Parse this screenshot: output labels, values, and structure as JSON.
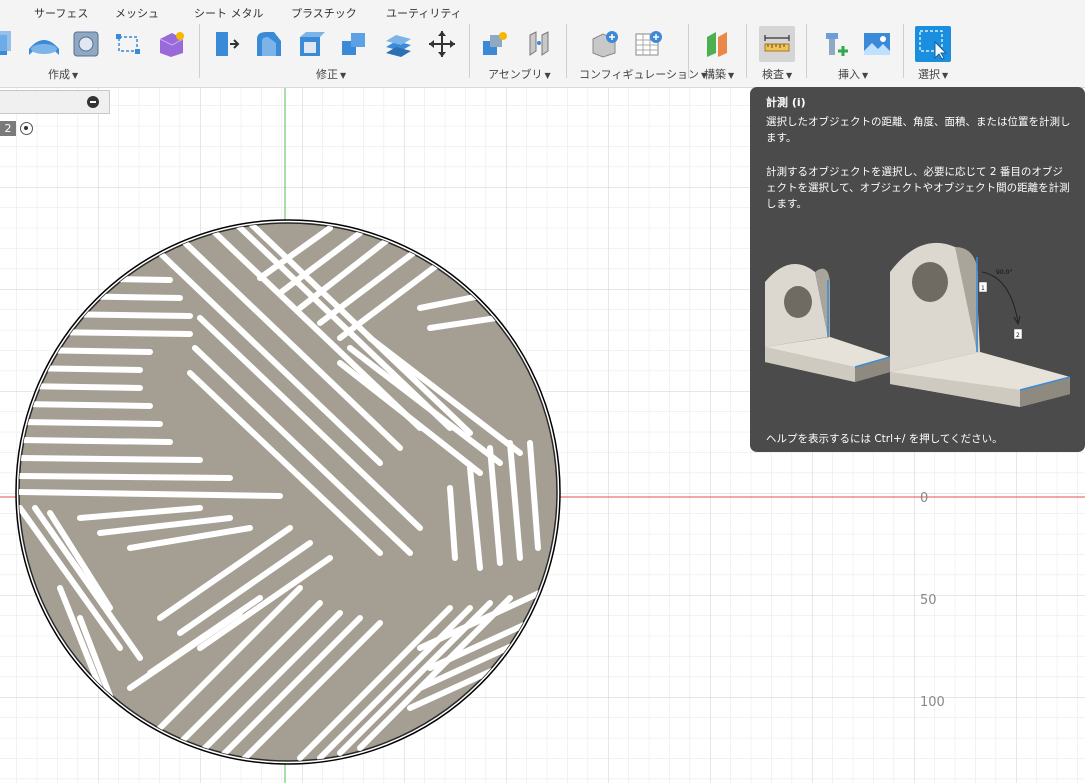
{
  "toolbar": {
    "tabs": [
      "サーフェス",
      "メッシュ",
      "シート メタル",
      "プラスチック",
      "ユーティリティ"
    ],
    "groups": {
      "create": "作成",
      "modify": "修正",
      "assemble": "アセンブリ",
      "configure": "コンフィギュレーション",
      "construct": "構築",
      "inspect": "検査",
      "insert": "挿入",
      "select": "選択"
    },
    "icons": [
      "extrude-icon",
      "revolve-icon",
      "hole-icon",
      "sketch-icon",
      "form-icon",
      "press-pull-icon",
      "fillet-icon",
      "shell-icon",
      "combine-icon",
      "offset-face-icon",
      "move-icon",
      "new-component-icon",
      "joint-icon",
      "configure-icon",
      "table-icon",
      "offset-plane-icon",
      "measure-icon",
      "insert-derive-icon",
      "insert-image-icon",
      "select-icon"
    ]
  },
  "browser": {
    "badge": "2"
  },
  "canvas": {
    "axis_labels": [
      "0",
      "50",
      "100"
    ],
    "colors": {
      "body": "#a59f93",
      "x_axis": "#e05050",
      "y_axis": "#50c050",
      "grid": "#e3e3e3",
      "grid_major": "#cfcfcf"
    }
  },
  "tooltip": {
    "title": "計測 (i)",
    "description": "選択したオブジェクトの距離、角度、面積、または位置を計測します。",
    "detail": "計測するオブジェクトを選択し、必要に応じて 2 番目のオブジェクトを選択して、オブジェクトやオブジェクト間の距離を計測します。",
    "illustration_labels": [
      "90.0°",
      "1",
      "2"
    ],
    "footer": "ヘルプを表示するには Ctrl+/ を押してください。"
  }
}
